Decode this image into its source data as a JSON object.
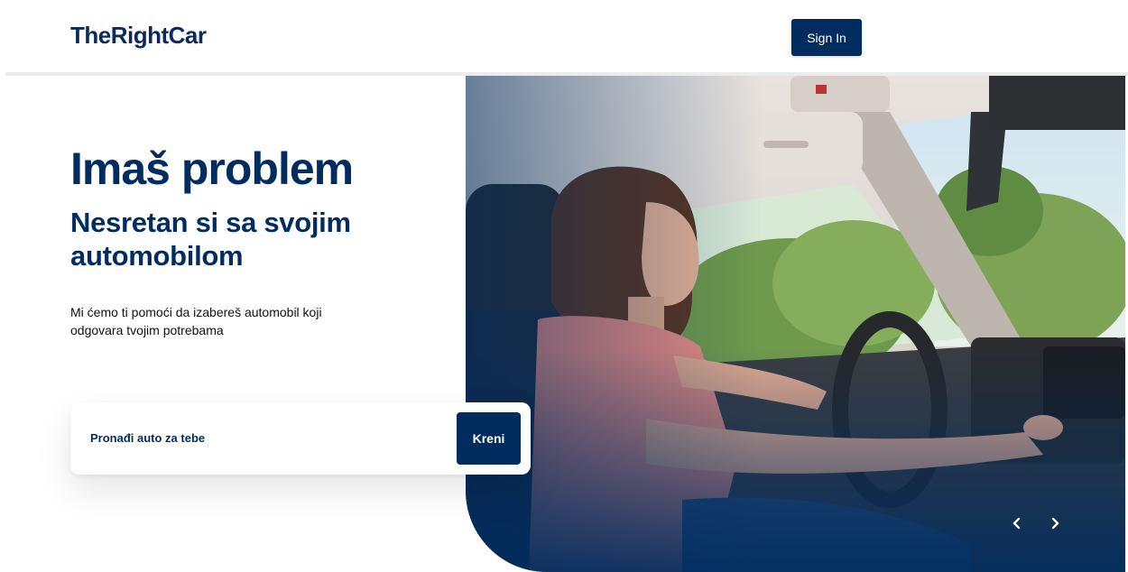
{
  "header": {
    "brand": "TheRightCar",
    "signin_label": "Sign In"
  },
  "hero": {
    "title": "Imaš problem",
    "subtitle": "Nesretan si sa svojim automobilom",
    "description": "Mi ćemo ti pomoći da izabereš automobil koji odgovara tvojim potrebama"
  },
  "search": {
    "label": "Pronađi auto za tebe",
    "button_label": "Kreni"
  },
  "carousel": {
    "prev_icon": "chevron-left-icon",
    "next_icon": "chevron-right-icon"
  },
  "colors": {
    "brand": "#002c5f",
    "background": "#ffffff"
  }
}
